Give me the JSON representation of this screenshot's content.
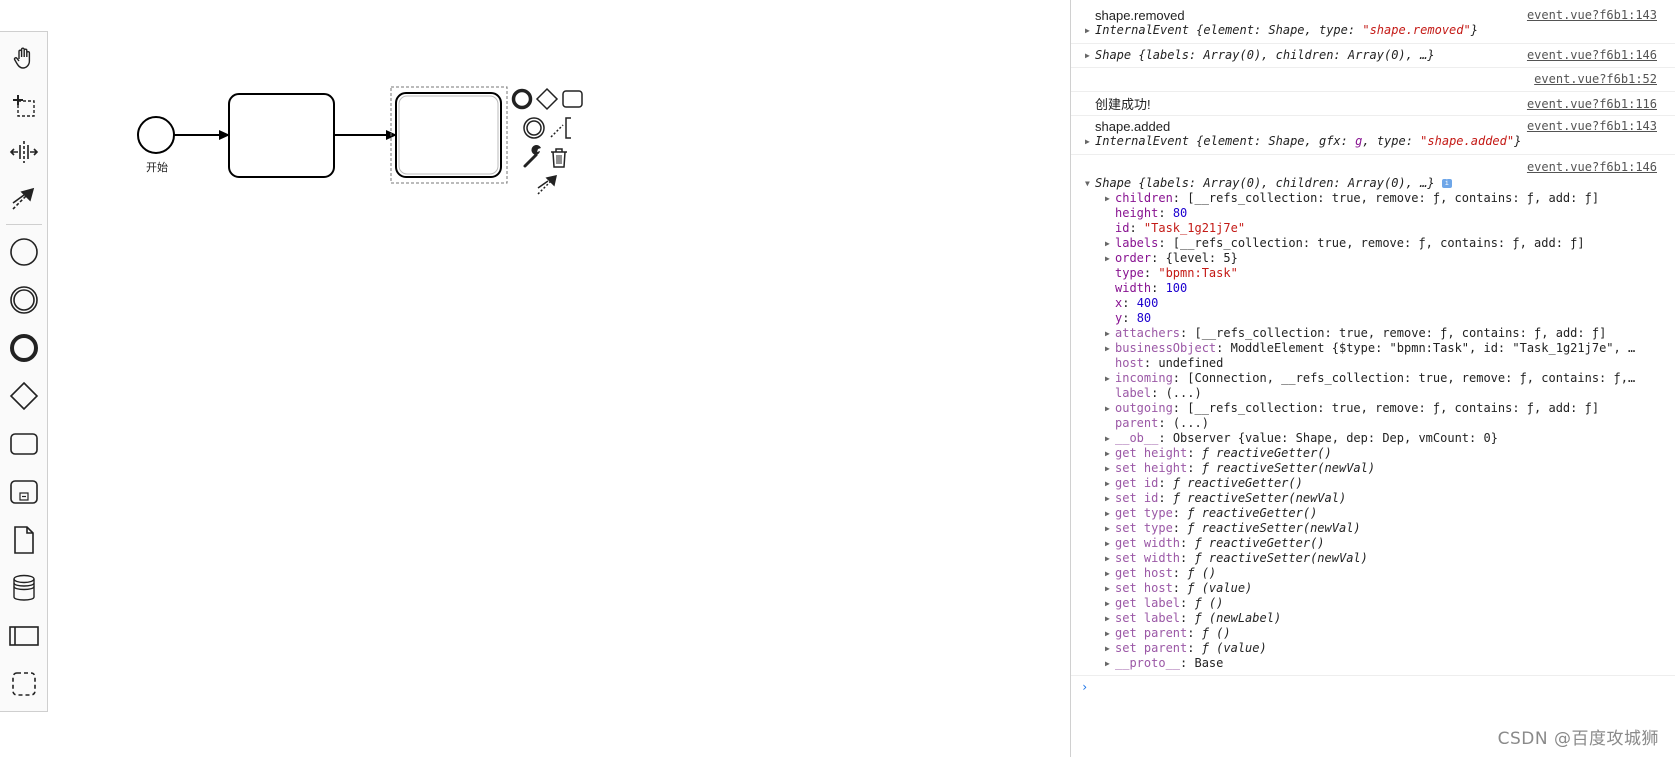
{
  "palette": {
    "items": [
      {
        "icon": "hand-tool-icon"
      },
      {
        "icon": "lasso-tool-icon"
      },
      {
        "icon": "space-tool-icon"
      },
      {
        "icon": "global-connect-tool-icon"
      },
      {
        "icon": "start-event-icon"
      },
      {
        "icon": "intermediate-event-icon"
      },
      {
        "icon": "end-event-icon"
      },
      {
        "icon": "gateway-icon"
      },
      {
        "icon": "task-icon"
      },
      {
        "icon": "subprocess-icon"
      },
      {
        "icon": "data-object-icon"
      },
      {
        "icon": "data-store-icon"
      },
      {
        "icon": "pool-participant-icon"
      },
      {
        "icon": "group-icon"
      }
    ]
  },
  "diagram": {
    "start_event_label": "开始",
    "context_pad": [
      "end-event-icon",
      "gateway-icon",
      "task-icon",
      "intermediate-event-icon",
      "text-annotation-icon",
      "wrench-icon",
      "trash-icon",
      "connect-icon"
    ]
  },
  "console": {
    "lines": {
      "m1_l1": "shape.removed",
      "m1_src1": "event.vue?f6b1:143",
      "m1_l2_obj": "InternalEvent",
      "m1_l2_a": " {",
      "m1_l2_k1": "element",
      "m1_l2_v1": ": Shape, ",
      "m1_l2_k2": "type",
      "m1_l2_s": "\"shape.removed\"",
      "m1_l2_end": "}",
      "m2_obj": "Shape",
      "m2_rest": " {labels: Array(0), children: Array(0), …}",
      "m2_src": "event.vue?f6b1:146",
      "m3_src": "event.vue?f6b1:52",
      "m4_text": "创建成功!",
      "m4_src": "event.vue?f6b1:116",
      "m5_l1": "shape.added",
      "m5_src": "event.vue?f6b1:143",
      "m5_obj": "InternalEvent",
      "m5_a": " {",
      "m5_k1": "element",
      "m5_v1": ": Shape, ",
      "m5_k2": "gfx",
      "m5_v2": ": ",
      "m5_g": "g",
      "m5_c": ", ",
      "m5_k3": "type",
      "m5_s": "\"shape.added\"",
      "m5_end": "}",
      "m6_src": "event.vue?f6b1:146",
      "m6_obj": "Shape",
      "m6_rest": " {labels: Array(0), children: Array(0), …}"
    },
    "props": [
      {
        "k": "children",
        "v": "[__refs_collection: true, remove: ƒ, contains: ƒ, add: ƒ]",
        "exp": true
      },
      {
        "k": "height",
        "num": "80"
      },
      {
        "k": "id",
        "str": "\"Task_1g21j7e\""
      },
      {
        "k": "labels",
        "v": "[__refs_collection: true, remove: ƒ, contains: ƒ, add: ƒ]",
        "exp": true
      },
      {
        "k": "order",
        "v": "{level: 5}",
        "exp": true
      },
      {
        "k": "type",
        "str": "\"bpmn:Task\""
      },
      {
        "k": "width",
        "num": "100"
      },
      {
        "k": "x",
        "num": "400"
      },
      {
        "k": "y",
        "num": "80"
      },
      {
        "k": "attachers",
        "v": "[__refs_collection: true, remove: ƒ, contains: ƒ, add: ƒ]",
        "exp": true,
        "faded": true
      },
      {
        "k": "businessObject",
        "v": "ModdleElement {$type: \"bpmn:Task\", id: \"Task_1g21j7e\", …",
        "exp": true,
        "faded": true
      },
      {
        "k": "host",
        "v": "undefined",
        "faded": true
      },
      {
        "k": "incoming",
        "v": "[Connection, __refs_collection: true, remove: ƒ, contains: ƒ,…",
        "exp": true,
        "faded": true
      },
      {
        "k": "label",
        "v": "(...)",
        "faded": true
      },
      {
        "k": "outgoing",
        "v": "[__refs_collection: true, remove: ƒ, contains: ƒ, add: ƒ]",
        "exp": true,
        "faded": true
      },
      {
        "k": "parent",
        "v": "(...)",
        "faded": true
      },
      {
        "k": "__ob__",
        "v": "Observer {value: Shape, dep: Dep, vmCount: 0}",
        "exp": true,
        "faded": true
      },
      {
        "k": "get height",
        "v": "ƒ reactiveGetter()",
        "exp": true,
        "faded": true
      },
      {
        "k": "set height",
        "v": "ƒ reactiveSetter(newVal)",
        "exp": true,
        "faded": true
      },
      {
        "k": "get id",
        "v": "ƒ reactiveGetter()",
        "exp": true,
        "faded": true
      },
      {
        "k": "set id",
        "v": "ƒ reactiveSetter(newVal)",
        "exp": true,
        "faded": true
      },
      {
        "k": "get type",
        "v": "ƒ reactiveGetter()",
        "exp": true,
        "faded": true
      },
      {
        "k": "set type",
        "v": "ƒ reactiveSetter(newVal)",
        "exp": true,
        "faded": true
      },
      {
        "k": "get width",
        "v": "ƒ reactiveGetter()",
        "exp": true,
        "faded": true
      },
      {
        "k": "set width",
        "v": "ƒ reactiveSetter(newVal)",
        "exp": true,
        "faded": true
      },
      {
        "k": "get host",
        "v": "ƒ ()",
        "exp": true,
        "faded": true
      },
      {
        "k": "set host",
        "v": "ƒ (value)",
        "exp": true,
        "faded": true
      },
      {
        "k": "get label",
        "v": "ƒ ()",
        "exp": true,
        "faded": true
      },
      {
        "k": "set label",
        "v": "ƒ (newLabel)",
        "exp": true,
        "faded": true
      },
      {
        "k": "get parent",
        "v": "ƒ ()",
        "exp": true,
        "faded": true
      },
      {
        "k": "set parent",
        "v": "ƒ (value)",
        "exp": true,
        "faded": true
      },
      {
        "k": "__proto__",
        "v": "Base",
        "exp": true,
        "faded": true
      }
    ],
    "prompt": "›"
  },
  "watermark": "CSDN @百度攻城狮"
}
